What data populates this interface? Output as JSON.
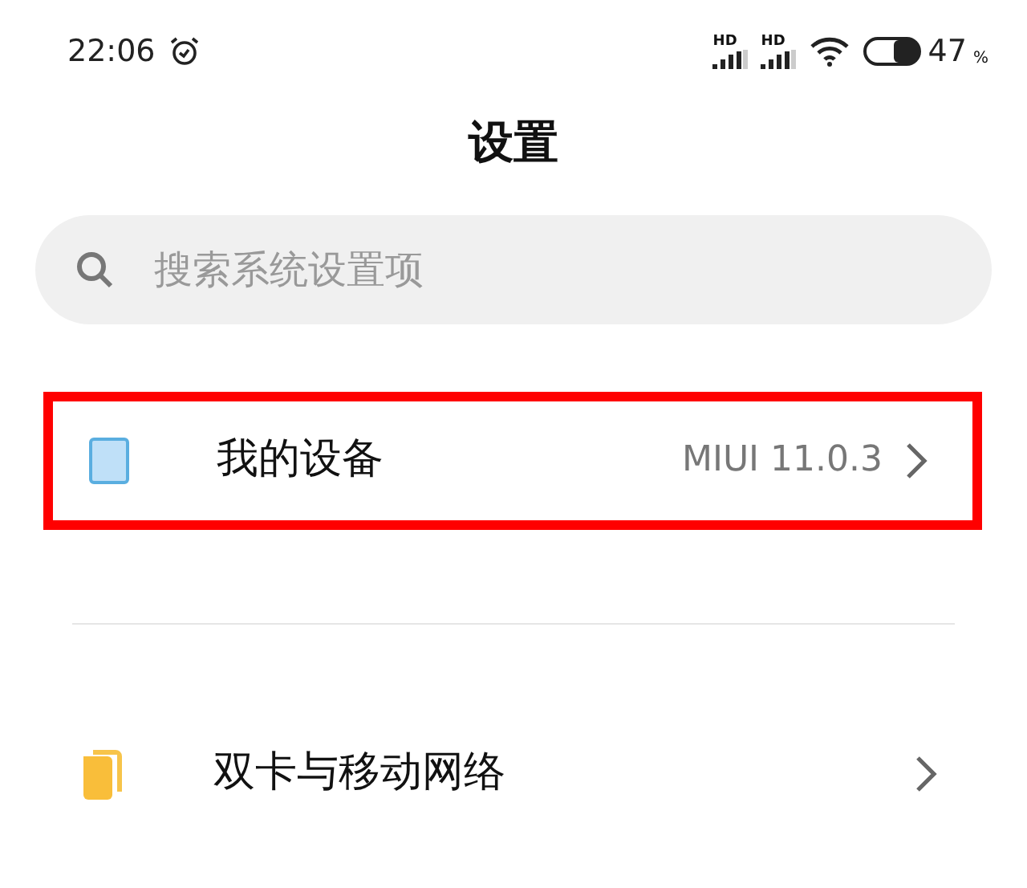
{
  "status_bar": {
    "time": "22:06",
    "signals": [
      {
        "label": "HD"
      },
      {
        "label": "HD"
      }
    ],
    "battery": {
      "level": 0.47,
      "percent": "47",
      "unit": "%"
    }
  },
  "title": "设置",
  "search": {
    "placeholder": "搜索系统设置项"
  },
  "items": [
    {
      "kind": "device",
      "label": "我的设备",
      "value": "MIUI 11.0.3",
      "highlighted": true
    },
    {
      "kind": "sim",
      "label": "双卡与移动网络",
      "highlighted": false
    }
  ]
}
